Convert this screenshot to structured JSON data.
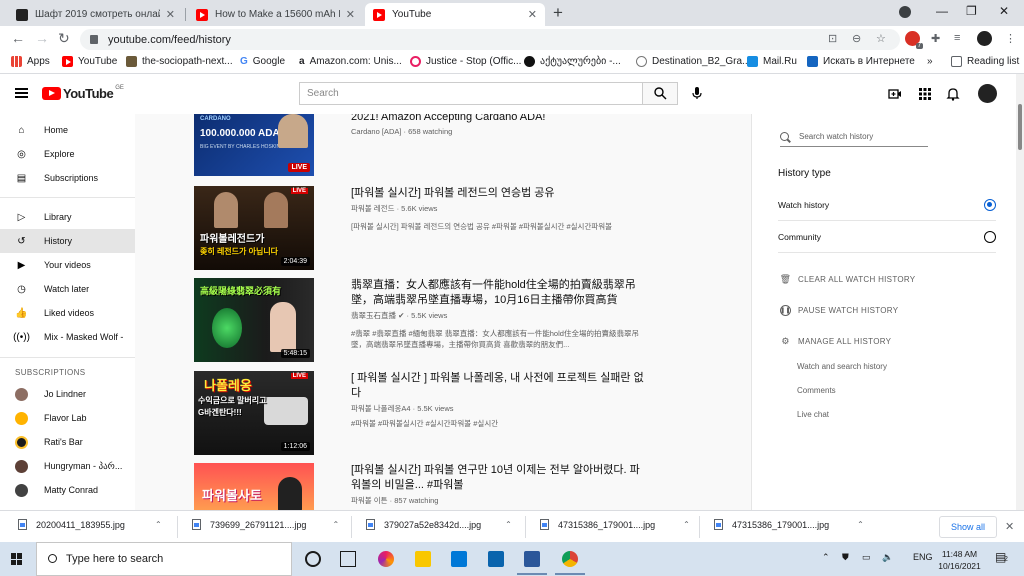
{
  "browser": {
    "tabs": [
      {
        "title": "Шафт 2019 смотреть онлайн бе",
        "icon": "film-reel-icon"
      },
      {
        "title": "How to Make a 15600 mAh Powe",
        "icon": "youtube-icon"
      },
      {
        "title": "YouTube",
        "icon": "youtube-icon",
        "active": true
      }
    ],
    "url": "youtube.com/feed/history",
    "bookmarks": [
      "Apps",
      "YouTube",
      "the-sociopath-next...",
      "Google",
      "Amazon.com: Unis...",
      "Justice - Stop (Offic...",
      "აქტუალურები -...",
      "Destination_B2_Gra...",
      "Mail.Ru",
      "Искать в Интернете",
      "Reading list"
    ],
    "bookmarks_more": "»"
  },
  "youtube": {
    "logo_text": "YouTube",
    "country_code": "GE",
    "search_placeholder": "Search"
  },
  "sidebar": {
    "items": [
      {
        "label": "Home",
        "icon": "home-icon"
      },
      {
        "label": "Explore",
        "icon": "compass-icon"
      },
      {
        "label": "Subscriptions",
        "icon": "subscriptions-icon"
      },
      {
        "label": "Library",
        "icon": "library-icon"
      },
      {
        "label": "History",
        "icon": "history-icon",
        "active": true
      },
      {
        "label": "Your videos",
        "icon": "your-videos-icon"
      },
      {
        "label": "Watch later",
        "icon": "clock-icon"
      },
      {
        "label": "Liked videos",
        "icon": "thumbs-up-icon"
      },
      {
        "label": "Mix - Masked Wolf -",
        "icon": "mix-icon"
      }
    ],
    "subscriptions_heading": "SUBSCRIPTIONS",
    "subscriptions": [
      "Jo Lindner",
      "Flavor Lab",
      "Rati's Bar",
      "Hungryman - პარ...",
      "Matty Conrad"
    ]
  },
  "videos": [
    {
      "title": "2021! Amazon Accepting Cardano ADA!",
      "meta": "Cardano [ADA] · 658 watching",
      "badge": "LIVE",
      "thumb_top": "CARDANO",
      "thumb_main": "100.000.000 ADA",
      "thumb_sub": "BIG EVENT BY CHARLES HOSKINSON"
    },
    {
      "title": "[파워볼 실시간] 파워볼 레전드의 연승법 공유",
      "meta": "파워볼 레전드 · 5.6K views",
      "desc": "[파워볼 실시간] 파워볼 레전드의 연승법 공유 #파워볼 #파워볼실시간 #실시간파워볼",
      "duration": "2:04:39",
      "badge_corner": "LIVE",
      "thumb_main": "파워볼레전드가",
      "thumb_sub": "좆히 레전드가 아닙니다"
    },
    {
      "title": "翡翠直播：女人都應該有一件能hold住全場的拍賣級翡翠吊墜，高端翡翠吊墜直播專場，10月16日主播帶你買高貨",
      "meta": "翡翠玉石直播",
      "views": "5.5K views",
      "desc": "#翡翠 #翡翠直播 #緬甸翡翠 翡翠直播：女人都應該有一件能hold住全場的拍賣級翡翠吊墜，高端翡翠吊墜直播專場，主播帶你買高貨 喜歡翡翠的朋友們...",
      "duration": "5:48:15",
      "thumb_main": "高級陽綠翡翠必須有"
    },
    {
      "title": "[ 파워볼 실시간 ] 파워볼 나폴레옹, 내 사전에 프로젝트 실패란 없다",
      "meta": "파워볼 나폴레옹A4 · 5.5K views",
      "desc": "#파워볼 #파워볼실시간 #실시간파워볼 #실시간",
      "duration": "1:12:06",
      "badge_corner": "LIVE",
      "thumb_main": "나폴레옹",
      "thumb_sub": "수익금으로 말버리고 G바겐탄다!!!"
    },
    {
      "title": "[파워볼 실시간] 파워볼 연구만 10년 이제는 전부 알아버렸다. 파워볼의 비밀을... #파워볼",
      "meta": "파워볼 이튼 · 857 watching",
      "thumb_main": "파워볼사토"
    }
  ],
  "history_panel": {
    "search_placeholder": "Search watch history",
    "type_heading": "History type",
    "types": [
      {
        "label": "Watch history",
        "selected": true
      },
      {
        "label": "Community",
        "selected": false
      }
    ],
    "actions": [
      {
        "label": "CLEAR ALL WATCH HISTORY",
        "icon": "trash-icon"
      },
      {
        "label": "PAUSE WATCH HISTORY",
        "icon": "pause-icon"
      },
      {
        "label": "MANAGE ALL HISTORY",
        "icon": "gear-icon"
      }
    ],
    "manage_links": [
      "Watch and search history",
      "Comments",
      "Live chat"
    ]
  },
  "downloads": {
    "files": [
      "20200411_183955.jpg",
      "739699_26791121....jpg",
      "379027a52e8342d....jpg",
      "47315386_179001....jpg",
      "47315386_179001....jpg"
    ],
    "show_all": "Show all"
  },
  "taskbar": {
    "search_placeholder": "Type here to search",
    "language": "ENG",
    "time": "11:48 AM",
    "date": "10/16/2021",
    "notification_count": "2",
    "ext_badge": "7"
  }
}
